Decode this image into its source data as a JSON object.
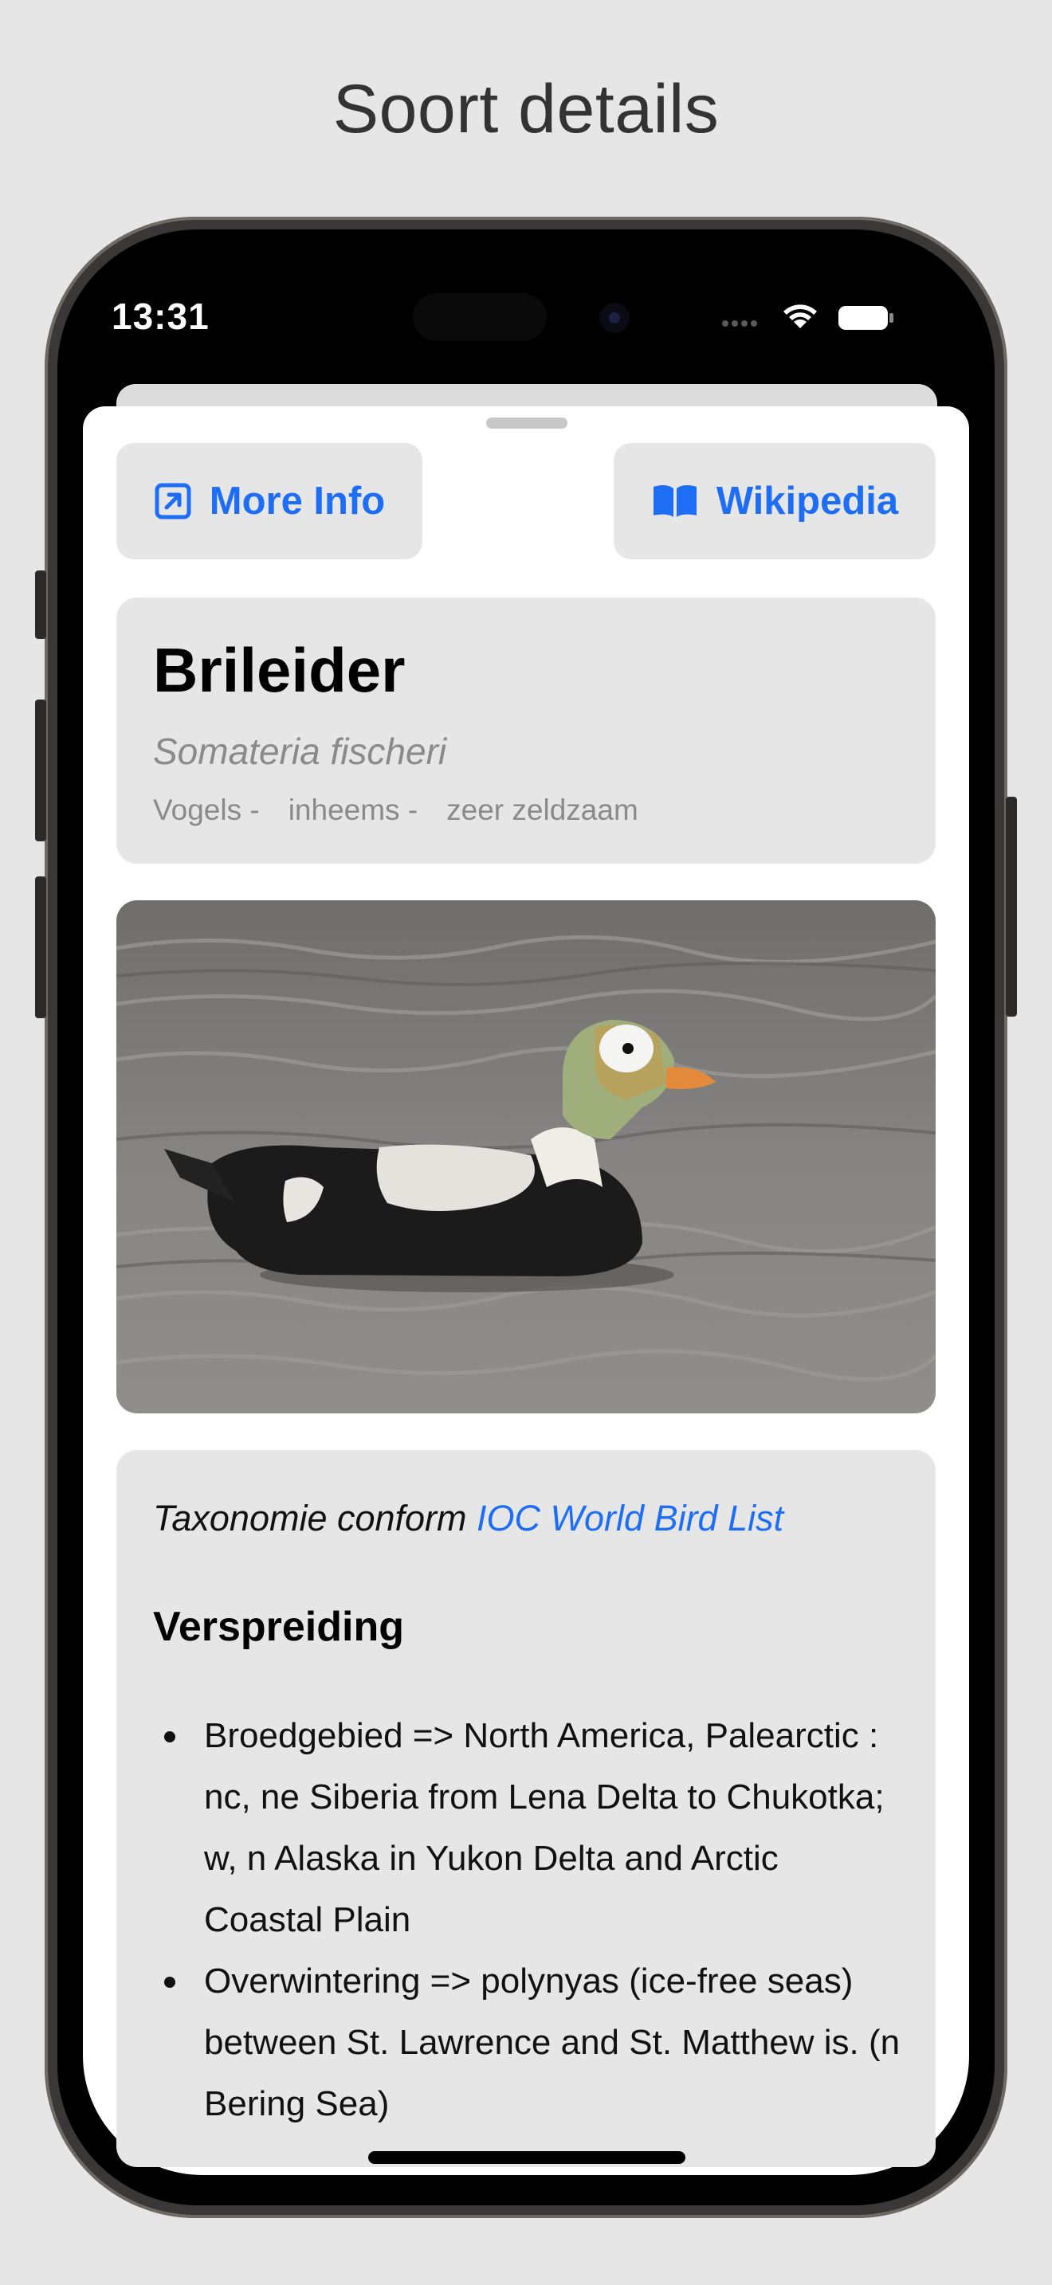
{
  "page": {
    "title": "Soort details"
  },
  "status_bar": {
    "time": "13:31",
    "signal_icon": "signal-dots-icon",
    "wifi_icon": "wifi-icon",
    "battery_icon": "battery-icon"
  },
  "actions": {
    "more_info": {
      "label": "More Info",
      "icon": "external-link-icon"
    },
    "wikipedia": {
      "label": "Wikipedia",
      "icon": "book-icon"
    }
  },
  "species": {
    "name": "Brileider",
    "scientific_name": "Somateria fischeri",
    "tags": [
      "Vogels -",
      "inheems -",
      "zeer zeldzaam"
    ]
  },
  "info": {
    "taxonomy_prefix": "Taxonomie conform",
    "taxonomy_link": "IOC World Bird List",
    "section_title": "Verspreiding",
    "distribution": [
      "Broedgebied => North America, Palearctic : nc, ne Siberia from Lena Delta to Chukotka; w, n Alaska in Yukon Delta and Arctic Coastal Plain",
      "Overwintering => polynyas (ice-free seas) between St. Lawrence and St. Matthew is. (n Bering Sea)"
    ]
  },
  "colors": {
    "accent": "#1d6ef5",
    "card_bg": "#e6e6e6",
    "secondary_text": "#8a8a8a"
  }
}
